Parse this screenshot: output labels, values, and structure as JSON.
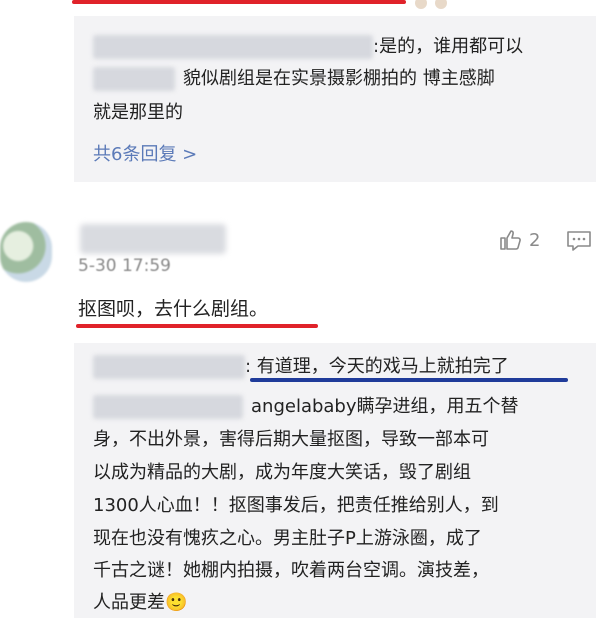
{
  "reply_thread_1": {
    "line1_text": ":是的，谁用都可以",
    "line2_text": "貌似剧组是在实景摄影棚拍的 博主感脚",
    "line3_text": "就是那里的",
    "more_replies": "共6条回复 >"
  },
  "comment": {
    "time": "5-30 17:59",
    "text": "抠图呗，去什么剧组。",
    "like_count": "2",
    "like_icon": "thumbs-up-icon",
    "comment_icon": "comment-icon"
  },
  "reply_thread_2": {
    "line1_text": ": 有道理，今天的戏马上就拍完了",
    "line2_text": "angelababy瞒孕进组，用五个替",
    "line3_text": "身，不出外景，害得后期大量抠图，导致一部本可",
    "line4_text": "以成为精品的大剧，成为年度大笑话，毁了剧组",
    "line5_text": "1300人心血！！抠图事发后，把责任推给别人，到",
    "line6_text": "现在也没有愧疚之心。男主肚子P上游泳圈，成了",
    "line7_text": "千古之谜！她棚内拍摄，吹着两台空调。演技差，",
    "line8_text": "人品更差",
    "emoji": "🙂"
  },
  "colors": {
    "red_annotation": "#e0222a",
    "blue_annotation": "#1f3b9a",
    "link_blue": "#5b7ab8",
    "reply_bg": "#f3f3f5"
  }
}
